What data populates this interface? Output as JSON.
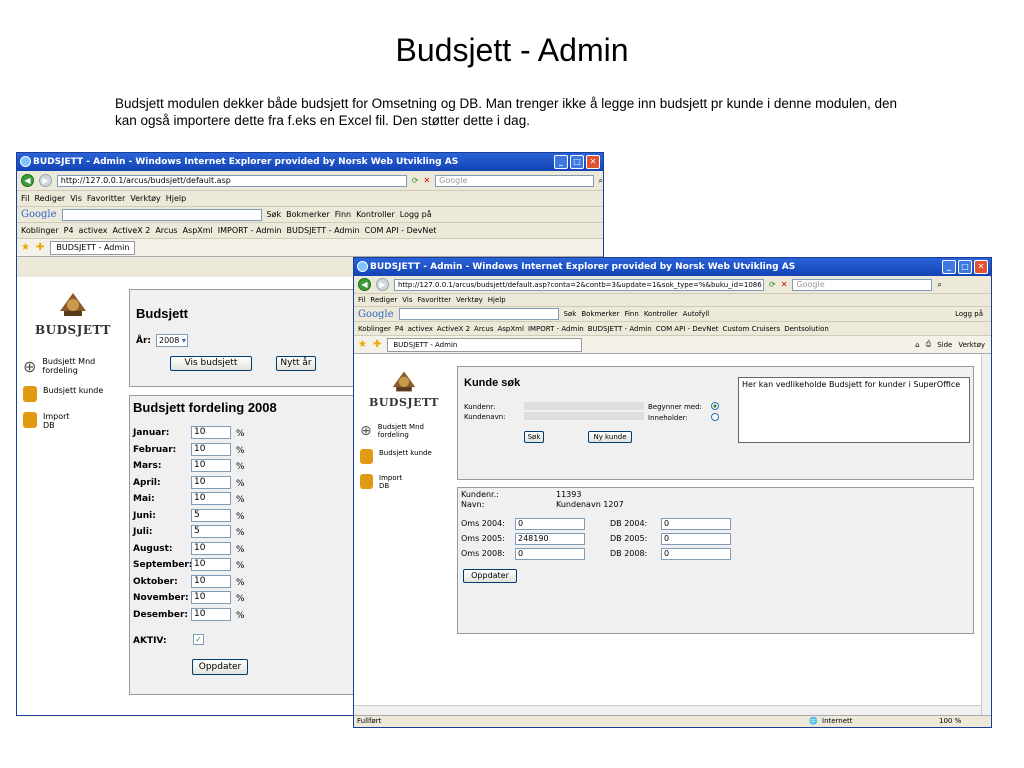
{
  "slide": {
    "title": "Budsjett - Admin",
    "description": "Budsjett modulen dekker både budsjett for Omsetning og DB. Man trenger ikke å legge inn budsjett pr kunde i denne modulen, den kan også importere dette fra f.eks en Excel fil. Den støtter dette i dag."
  },
  "win1": {
    "title": "BUDSJETT - Admin - Windows Internet Explorer provided by Norsk Web Utvikling AS",
    "address": "http://127.0.0.1/arcus/budsjett/default.asp",
    "search_placeholder": "Google",
    "menu": [
      "Fil",
      "Rediger",
      "Vis",
      "Favoritter",
      "Verktøy",
      "Hjelp"
    ],
    "google": "Google",
    "toolbar_items": [
      "Søk",
      "Bokmerker",
      "Finn",
      "Kontroller",
      "Logg på"
    ],
    "links_label": "Koblinger",
    "links": [
      "P4",
      "activex",
      "ActiveX 2",
      "Arcus",
      "AspXml",
      "IMPORT - Admin",
      "BUDSJETT - Admin",
      "COM API - DevNet"
    ],
    "tab": "BUDSJETT - Admin",
    "brand": "BUDSJETT",
    "sidebar": [
      "Budsjett Mnd fordeling",
      "Budsjett kunde",
      "Import DB"
    ],
    "budsjett_heading": "Budsjett",
    "year_label": "År:",
    "year_value": "2008",
    "vis_button": "Vis budsjett",
    "nytt_button": "Nytt år",
    "fordeling_heading": "Budsjett fordeling 2008",
    "months": [
      {
        "name": "Januar:",
        "value": "10"
      },
      {
        "name": "Februar:",
        "value": "10"
      },
      {
        "name": "Mars:",
        "value": "10"
      },
      {
        "name": "April:",
        "value": "10"
      },
      {
        "name": "Mai:",
        "value": "10"
      },
      {
        "name": "Juni:",
        "value": "5"
      },
      {
        "name": "Juli:",
        "value": "5"
      },
      {
        "name": "August:",
        "value": "10"
      },
      {
        "name": "September:",
        "value": "10"
      },
      {
        "name": "Oktober:",
        "value": "10"
      },
      {
        "name": "November:",
        "value": "10"
      },
      {
        "name": "Desember:",
        "value": "10"
      }
    ],
    "percent": "%",
    "aktiv_label": "AKTIV:",
    "oppdater": "Oppdater"
  },
  "win2": {
    "title": "BUDSJETT - Admin - Windows Internet Explorer provided by Norsk Web Utvikling AS",
    "address": "http://127.0.0.1/arcus/budsjett/default.asp?conta=2&contb=3&update=1&sok_type=%&buku_id=1086",
    "search_placeholder": "Google",
    "menu": [
      "Fil",
      "Rediger",
      "Vis",
      "Favoritter",
      "Verktøy",
      "Hjelp"
    ],
    "google": "Google",
    "toolbar_items": [
      "Søk",
      "Bokmerker",
      "Finn",
      "Kontroller",
      "Autofyll",
      "Logg på"
    ],
    "links_label": "Koblinger",
    "links": [
      "P4",
      "activex",
      "ActiveX 2",
      "Arcus",
      "AspXml",
      "IMPORT - Admin",
      "BUDSJETT - Admin",
      "COM API - DevNet",
      "Custom Cruisers",
      "Dentsolution"
    ],
    "tab": "BUDSJETT - Admin",
    "tab_tools": [
      "Side",
      "Verktøy"
    ],
    "brand": "BUDSJETT",
    "sidebar": [
      "Budsjett Mnd fordeling",
      "Budsjett kunde",
      "Import DB"
    ],
    "kunde_heading": "Kunde søk",
    "kundenr_label": "Kundenr:",
    "kundenavn_label": "Kundenavn:",
    "begynner_label": "Begynner med:",
    "inneholder_label": "Inneholder:",
    "sok_button": "Søk",
    "ny_kunde_button": "Ny kunde",
    "info_text": "Her kan vedlikeholde Budsjett for kunder i SuperOffice",
    "detail_kundenr_label": "Kundenr.:",
    "detail_kundenr_value": "11393",
    "detail_navn_label": "Navn:",
    "detail_navn_value": "Kundenavn 1207",
    "oms": [
      {
        "label": "Oms 2004:",
        "value": "0"
      },
      {
        "label": "Oms 2005:",
        "value": "248190"
      },
      {
        "label": "Oms 2008:",
        "value": "0"
      }
    ],
    "db": [
      {
        "label": "DB 2004:",
        "value": "0"
      },
      {
        "label": "DB 2005:",
        "value": "0"
      },
      {
        "label": "DB 2008:",
        "value": "0"
      }
    ],
    "oppdater": "Oppdater",
    "status_left": "Fullført",
    "status_zone": "Internett",
    "status_zoom": "100 %"
  }
}
